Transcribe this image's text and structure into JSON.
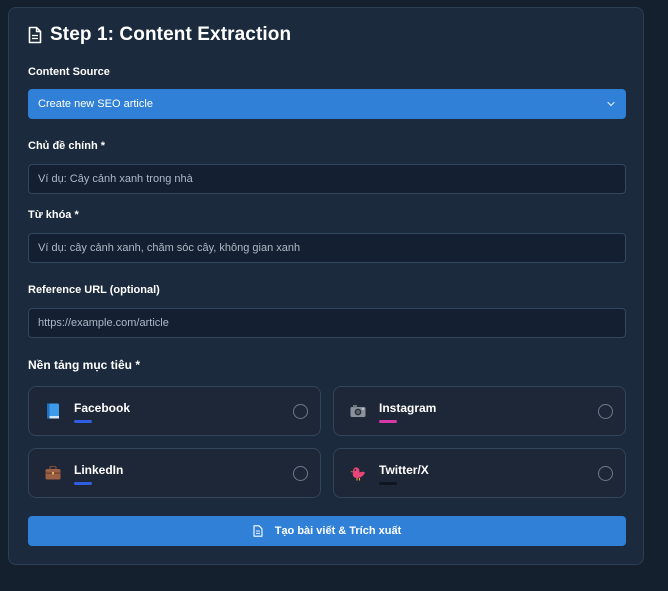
{
  "step": {
    "title": "Step 1: Content Extraction"
  },
  "content_source": {
    "label": "Content Source",
    "selected": "Create new SEO article"
  },
  "topic": {
    "label": "Chủ đề chính *",
    "placeholder": "Ví dụ: Cây cảnh xanh trong nhà"
  },
  "keywords": {
    "label": "Từ khóa *",
    "placeholder": "Ví dụ: cây cảnh xanh, chăm sóc cây, không gian xanh"
  },
  "reference_url": {
    "label": "Reference URL (optional)",
    "placeholder": "https://example.com/article"
  },
  "platforms": {
    "title": "Nền tảng mục tiêu *",
    "items": [
      {
        "name": "Facebook",
        "icon": "blue-book-icon",
        "color": "#2f5fe0"
      },
      {
        "name": "Instagram",
        "icon": "camera-icon",
        "color": "#d63aa8"
      },
      {
        "name": "LinkedIn",
        "icon": "briefcase-icon",
        "color": "#2f5fe0"
      },
      {
        "name": "Twitter/X",
        "icon": "bird-icon",
        "color": "#0f1620"
      }
    ]
  },
  "submit": {
    "label": "Tạo bài viết & Trích xuất"
  },
  "colors": {
    "accent": "#2f80d6",
    "panel": "#1b2a3c",
    "background": "#15202e"
  }
}
